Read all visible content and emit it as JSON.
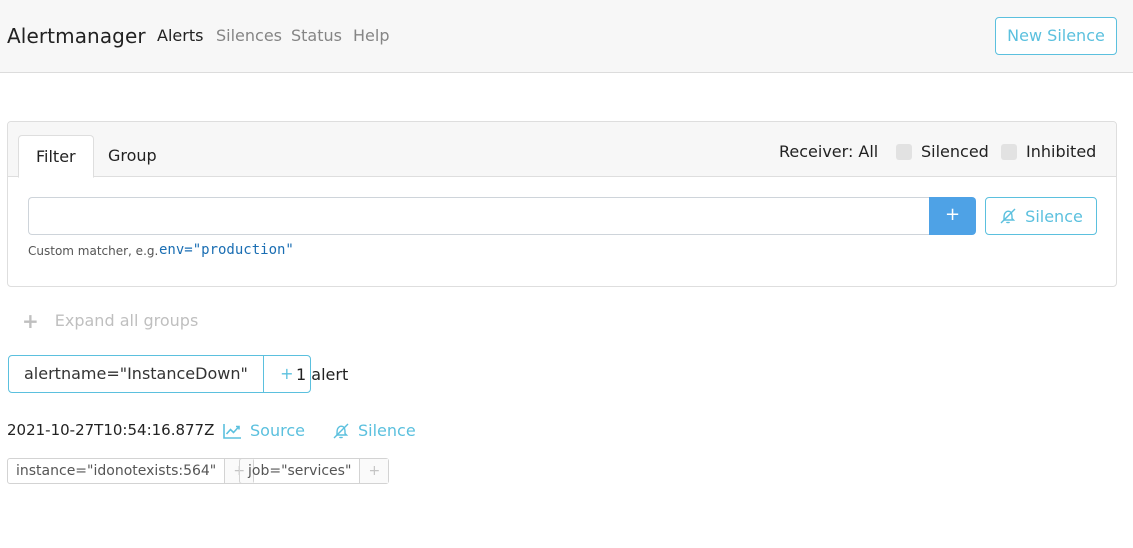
{
  "app": {
    "brand": "Alertmanager"
  },
  "nav": {
    "links": [
      {
        "label": "Alerts",
        "active": true
      },
      {
        "label": "Silences",
        "active": false
      },
      {
        "label": "Status",
        "active": false
      },
      {
        "label": "Help",
        "active": false
      }
    ],
    "new_silence_label": "New Silence"
  },
  "filter_card": {
    "tabs": [
      {
        "label": "Filter",
        "active": true
      },
      {
        "label": "Group",
        "active": false
      }
    ],
    "receiver_label": "Receiver: All",
    "silenced_label": "Silenced",
    "silenced_checked": false,
    "inhibited_label": "Inhibited",
    "inhibited_checked": false,
    "input_value": "",
    "add_button_label": "+",
    "silence_button_label": "Silence",
    "hint_text": "Custom matcher, e.g.",
    "hint_example": "env=\"production\""
  },
  "expand_all_label": "Expand all groups",
  "group": {
    "label": "alertname=\"InstanceDown\"",
    "plus": "+",
    "count_text": "1 alert"
  },
  "alert": {
    "timestamp": "2021-10-27T10:54:16.877Z",
    "source_label": "Source",
    "silence_label": "Silence",
    "labels": [
      {
        "text": "instance=\"idonotexists:564\"",
        "plus": "+"
      },
      {
        "text": "job=\"services\"",
        "plus": "+"
      }
    ]
  },
  "colors": {
    "accent": "#5bc0de",
    "primary": "#4ea2e6",
    "navbar_bg": "#f7f7f7"
  }
}
